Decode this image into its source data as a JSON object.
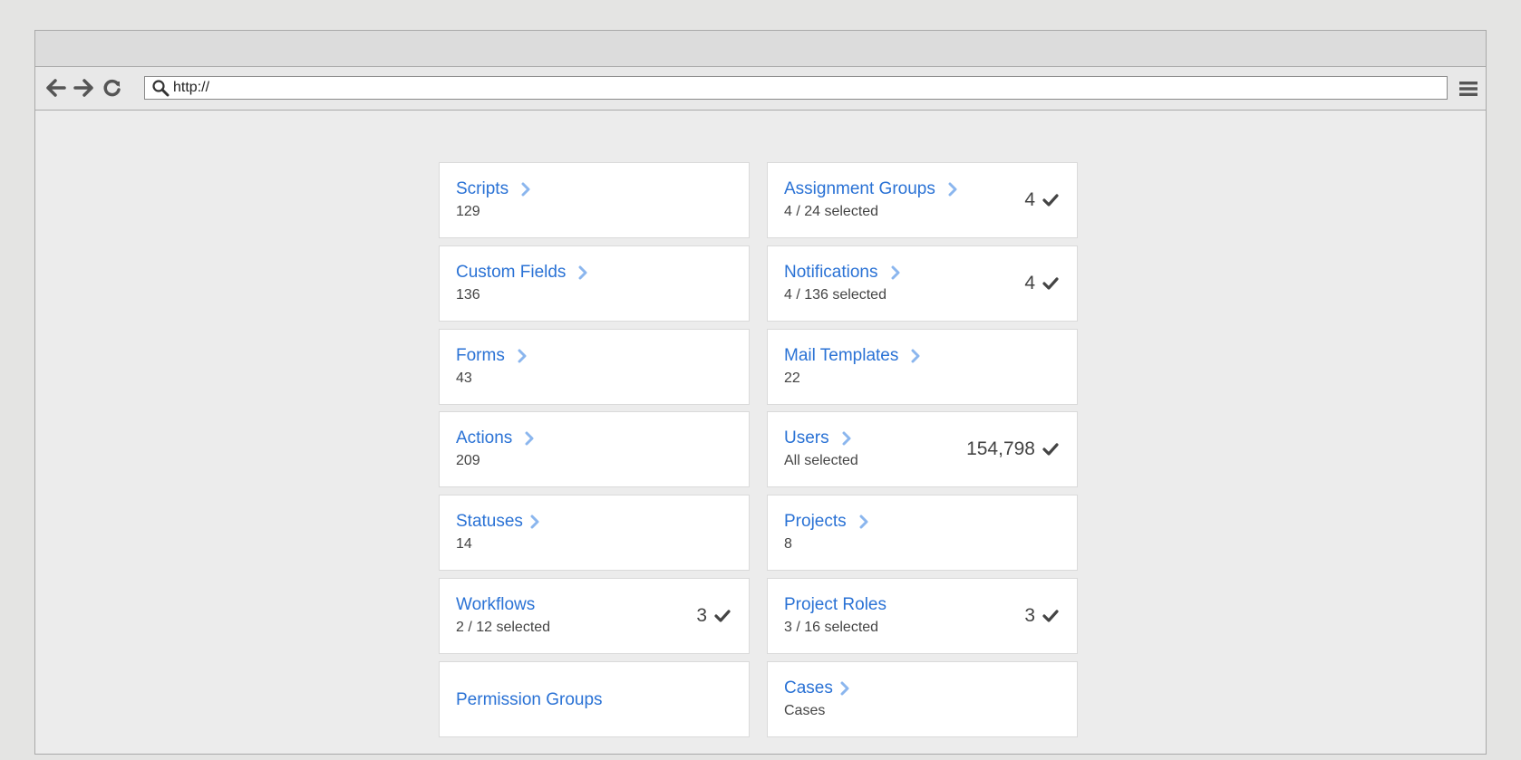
{
  "browser": {
    "url_value": "http://"
  },
  "cards": {
    "scripts": {
      "title": "Scripts",
      "sub": "129"
    },
    "assignment_groups": {
      "title": "Assignment Groups",
      "sub": "4 / 24 selected",
      "count": "4"
    },
    "custom_fields": {
      "title": "Custom Fields",
      "sub": "136"
    },
    "notifications": {
      "title": "Notifications",
      "sub": "4 / 136 selected",
      "count": "4"
    },
    "forms": {
      "title": "Forms",
      "sub": "43"
    },
    "mail_templates": {
      "title": "Mail Templates",
      "sub": "22"
    },
    "actions": {
      "title": "Actions",
      "sub": "209"
    },
    "users": {
      "title": "Users",
      "sub": "All selected",
      "count": "154,798"
    },
    "statuses": {
      "title": "Statuses",
      "sub": "14"
    },
    "projects": {
      "title": "Projects",
      "sub": "8"
    },
    "workflows": {
      "title": "Workflows",
      "sub": "2 / 12 selected",
      "count": "3"
    },
    "project_roles": {
      "title": "Project Roles",
      "sub": "3 / 16 selected",
      "count": "3"
    },
    "permission_groups": {
      "title": "Permission Groups"
    },
    "cases": {
      "title": "Cases",
      "sub": "Cases"
    }
  },
  "colors": {
    "link": "#2a72d5",
    "chevron": "#8bb6ee",
    "check": "#444444"
  },
  "icons": [
    "back-arrow-icon",
    "forward-arrow-icon",
    "reload-icon",
    "search-icon",
    "hamburger-menu-icon",
    "chevron-right-icon",
    "checkmark-icon"
  ]
}
